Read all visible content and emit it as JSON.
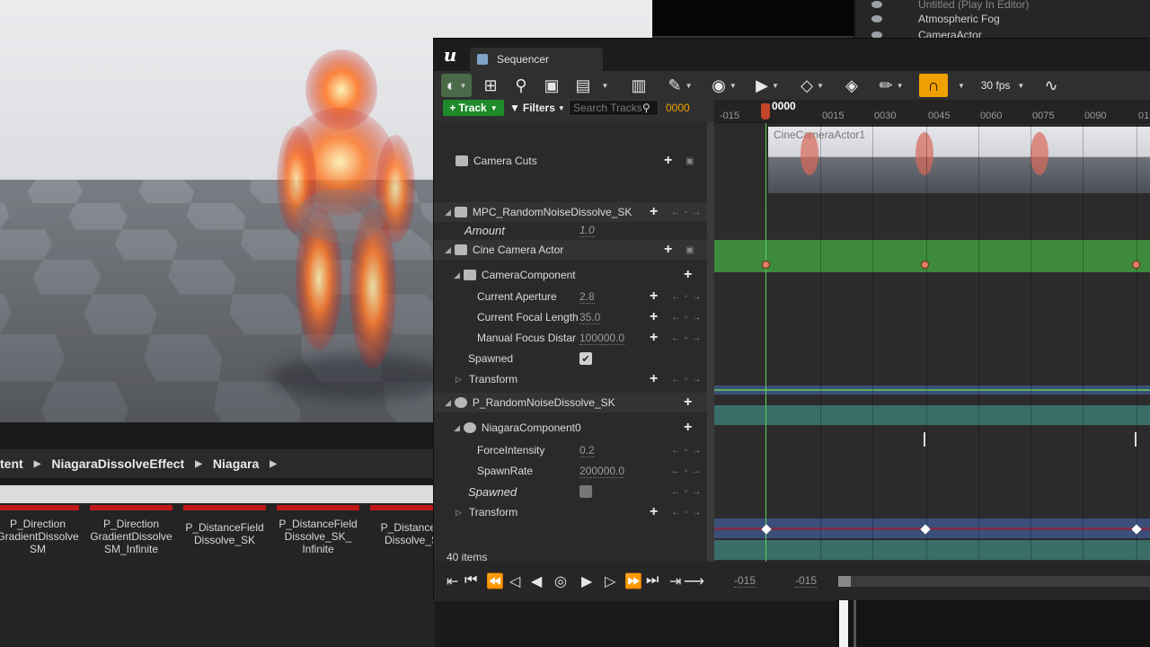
{
  "outliner": {
    "row0": "Untitled (Play In Editor)",
    "row1": "Atmospheric Fog",
    "row2": "CameraActor"
  },
  "breadcrumb": [
    "tent",
    "NiagaraDissolveEffect",
    "Niagara"
  ],
  "content_browser": {
    "assets": [
      {
        "name": "P_Direction GradientDissolve SM"
      },
      {
        "name": "P_Direction GradientDissolve SM_Infinite"
      },
      {
        "name": "P_DistanceField Dissolve_SK"
      },
      {
        "name": "P_DistanceField Dissolve_SK_ Infinite"
      },
      {
        "name": "P_DistanceF Dissolve_S"
      }
    ],
    "items_count": "40 items"
  },
  "sequencer": {
    "tab_title": "Sequencer",
    "fps_label": "30 fps",
    "track_button": "Track",
    "filters_button": "Filters",
    "search_placeholder": "Search Tracks",
    "current_time": "0000",
    "playhead_label": "0000",
    "ruler_ticks": [
      "-015",
      "0015",
      "0030",
      "0045",
      "0060",
      "0075",
      "0090",
      "01"
    ],
    "tracks": {
      "camera_cuts": "Camera Cuts",
      "mpc": "MPC_RandomNoiseDissolve_SK",
      "amount": {
        "label": "Amount",
        "value": "1.0"
      },
      "cine_camera": "Cine Camera Actor",
      "camera_component": "CameraComponent",
      "aperture": {
        "label": "Current Aperture",
        "value": "2.8"
      },
      "focal": {
        "label": "Current Focal Length",
        "value": "35.0"
      },
      "focus": {
        "label": "Manual Focus Distar",
        "value": "100000.0"
      },
      "spawned1": {
        "label": "Spawned",
        "checked": true
      },
      "transform1": "Transform",
      "niagara_actor": "P_RandomNoiseDissolve_SK",
      "niagara_component": "NiagaraComponent0",
      "force": {
        "label": "ForceIntensity",
        "value": "0.2"
      },
      "spawnrate": {
        "label": "SpawnRate",
        "value": "200000.0"
      },
      "spawned2": {
        "label": "Spawned",
        "checked": false
      },
      "transform2": "Transform"
    },
    "camera_section_label": "CineCameraActor1",
    "view_start": "-015",
    "view_end": "-015",
    "colors": {
      "accent": "#f0a000",
      "track_green": "#1e8a2a",
      "mpc_lane": "#3d8a3d",
      "spawned_lane": "#3c4f7a",
      "transform_lane": "#3a6e68",
      "niagara_spawned_lane": "#7a2f4c"
    }
  }
}
